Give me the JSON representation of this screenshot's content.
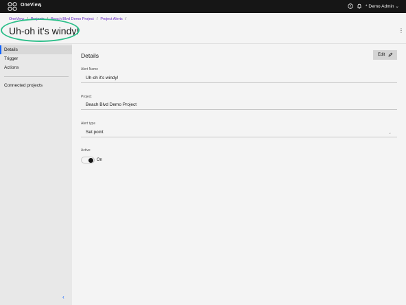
{
  "topbar": {
    "app_name": "OneView",
    "app_chevron": "⌄",
    "user_label": "* Demo Admin ⌄",
    "icons": [
      "oneview-logo-icon",
      "help-icon",
      "bell-icon"
    ]
  },
  "header": {
    "breadcrumbs": [
      "OneView",
      "Projects",
      "Beach Blvd Demo Project",
      "Project Alerts"
    ],
    "title": "Uh-oh it's windy!",
    "menu_glyph": "⋮",
    "highlight_color": "#2dbf8a"
  },
  "sidebar": {
    "items": [
      {
        "label": "Details",
        "active": true
      },
      {
        "label": "Trigger",
        "active": false
      },
      {
        "label": "Actions",
        "active": false
      },
      {
        "label": "Connected projects",
        "active": false
      }
    ],
    "collapse_glyph": "‹"
  },
  "details": {
    "title": "Details",
    "edit_label": "Edit",
    "fields": {
      "alert_name": {
        "label": "Alert Name",
        "value": "Uh-oh it's windy!"
      },
      "project": {
        "label": "Project",
        "value": "Beach Blvd Demo Project"
      },
      "alert_type": {
        "label": "Alert type",
        "value": "Set point"
      },
      "active": {
        "label": "Active",
        "value": "On"
      }
    }
  },
  "colors": {
    "accent": "#0f62fe",
    "link": "#6929c4",
    "topbar": "#161616"
  }
}
